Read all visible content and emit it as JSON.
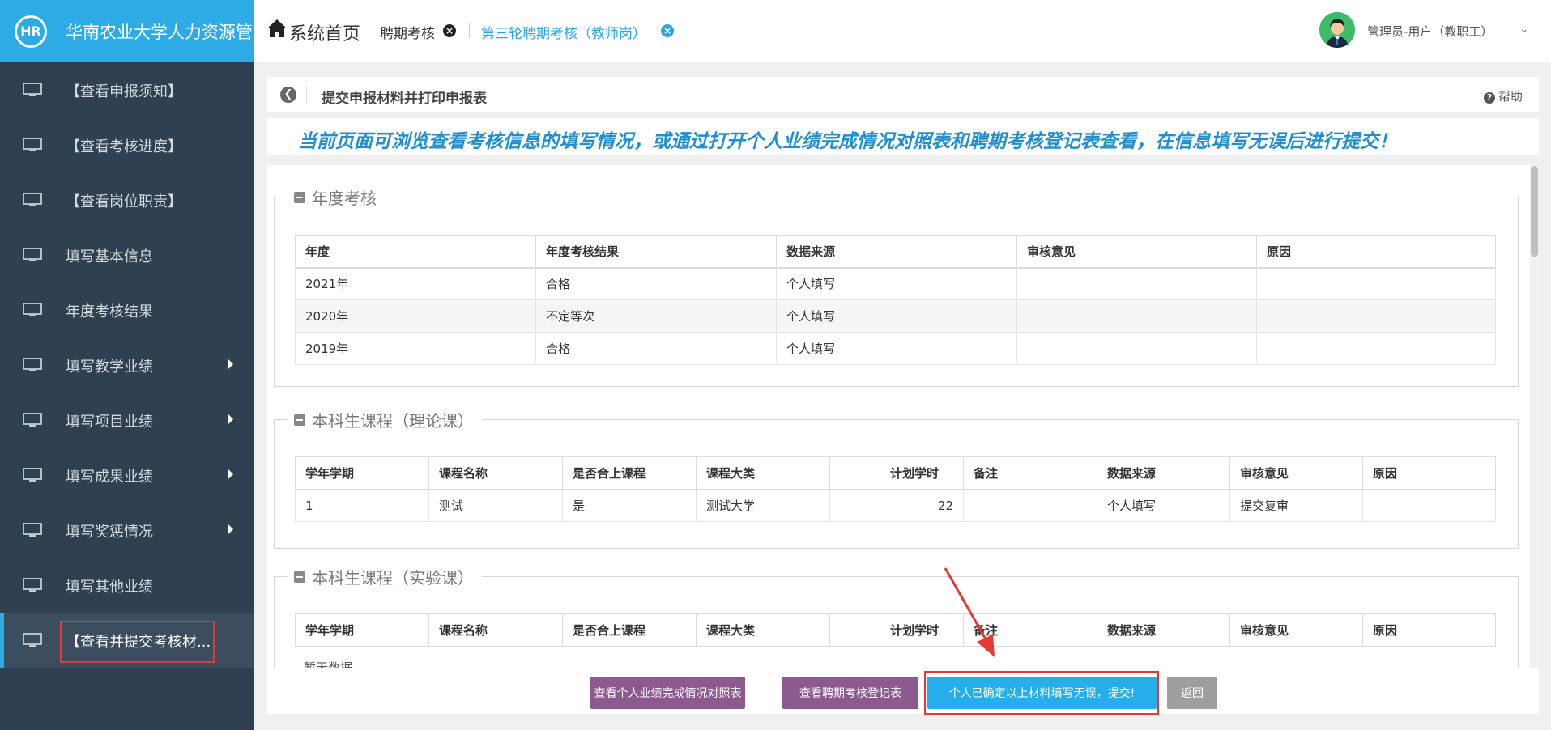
{
  "brand": {
    "logo_text": "HR",
    "title": "华南农业大学人力资源管"
  },
  "sidebar": {
    "items": [
      {
        "label": "【查看申报须知】",
        "has_submenu": false
      },
      {
        "label": "【查看考核进度】",
        "has_submenu": false
      },
      {
        "label": "【查看岗位职责】",
        "has_submenu": false
      },
      {
        "label": "填写基本信息",
        "has_submenu": false
      },
      {
        "label": "年度考核结果",
        "has_submenu": false
      },
      {
        "label": "填写教学业绩",
        "has_submenu": true
      },
      {
        "label": "填写项目业绩",
        "has_submenu": true
      },
      {
        "label": "填写成果业绩",
        "has_submenu": true
      },
      {
        "label": "填写奖惩情况",
        "has_submenu": true
      },
      {
        "label": "填写其他业绩",
        "has_submenu": false
      },
      {
        "label": "【查看并提交考核材...",
        "has_submenu": false,
        "active": true
      }
    ]
  },
  "topbar": {
    "home": "系统首页",
    "tabs": [
      {
        "label": "聘期考核"
      },
      {
        "label": "第三轮聘期考核（教师岗）",
        "active": true
      }
    ],
    "user": "管理员-用户（教职工）"
  },
  "panel": {
    "title": "提交申报材料并打印申报表",
    "help": "帮助",
    "notice": "当前页面可浏览查看考核信息的填写情况，或通过打开个人业绩完成情况对照表和聘期考核登记表查看，在信息填写无误后进行提交！"
  },
  "annual": {
    "legend": "年度考核",
    "columns": [
      "年度",
      "年度考核结果",
      "数据来源",
      "审核意见",
      "原因"
    ],
    "rows": [
      [
        "2021年",
        "合格",
        "个人填写",
        "",
        ""
      ],
      [
        "2020年",
        "不定等次",
        "个人填写",
        "",
        ""
      ],
      [
        "2019年",
        "合格",
        "个人填写",
        "",
        ""
      ]
    ]
  },
  "theory": {
    "legend": "本科生课程（理论课）",
    "columns": [
      "学年学期",
      "课程名称",
      "是否合上课程",
      "课程大类",
      "计划学时",
      "备注",
      "数据来源",
      "审核意见",
      "原因"
    ],
    "rows": [
      [
        "1",
        "测试",
        "是",
        "测试大学",
        "22",
        "",
        "个人填写",
        "提交复审",
        ""
      ]
    ]
  },
  "lab": {
    "legend": "本科生课程（实验课）",
    "columns": [
      "学年学期",
      "课程名称",
      "是否合上课程",
      "课程大类",
      "计划学时",
      "备注",
      "数据来源",
      "审核意见",
      "原因"
    ],
    "empty": "暂无数据"
  },
  "footer": {
    "btn_compare": "查看个人业绩完成情况对照表",
    "btn_register": "查看聘期考核登记表",
    "btn_submit": "个人已确定以上材料填写无误，提交!",
    "btn_back": "返回"
  },
  "colors": {
    "sidebar_bg": "#2f4050",
    "accent": "#2dabe5",
    "highlight": "#e53935",
    "notice": "#1f8fd1"
  }
}
